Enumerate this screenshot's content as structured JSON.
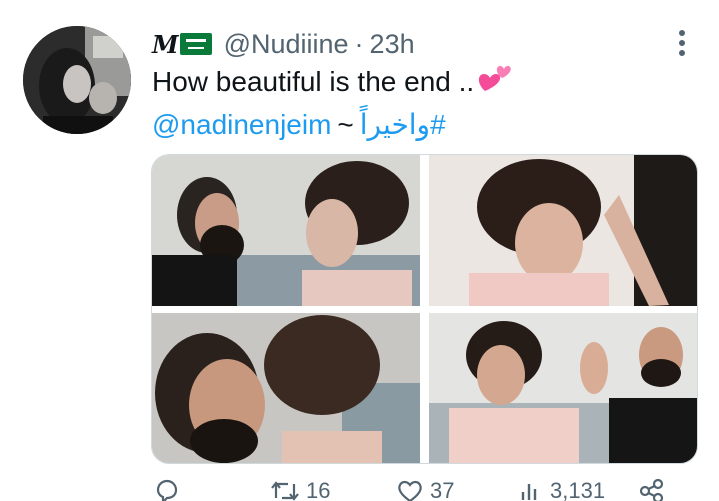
{
  "tweet": {
    "display_name": "M",
    "flag_icon": "saudi-flag-icon",
    "handle": "@Nudiiine",
    "separator": "·",
    "time": "23h",
    "text_line1": "How beautiful is the end ..",
    "emoji_icon": "two-hearts-icon",
    "mention": "@nadinenjeim",
    "tilde": "~",
    "hashtag": "#واخيراً",
    "more_icon": "more-vertical-icon"
  },
  "media": {
    "photos": [
      {
        "name": "photo-couple-facing",
        "bg": "#c9c9c6"
      },
      {
        "name": "photo-bride-dancing",
        "bg": "#e2ddd8"
      },
      {
        "name": "photo-couple-embrace",
        "bg": "#bdbab5"
      },
      {
        "name": "photo-couple-clapping",
        "bg": "#dcdcda"
      }
    ]
  },
  "actions": {
    "reply_icon": "reply-icon",
    "retweet_icon": "retweet-icon",
    "retweet_count": "16",
    "like_icon": "heart-icon",
    "like_count": "37",
    "views_icon": "views-icon",
    "views_count": "3,131",
    "share_icon": "share-icon"
  },
  "colors": {
    "link": "#1d9bf0",
    "secondary": "#536471",
    "text": "#0f1419",
    "border": "#cfd9de"
  }
}
